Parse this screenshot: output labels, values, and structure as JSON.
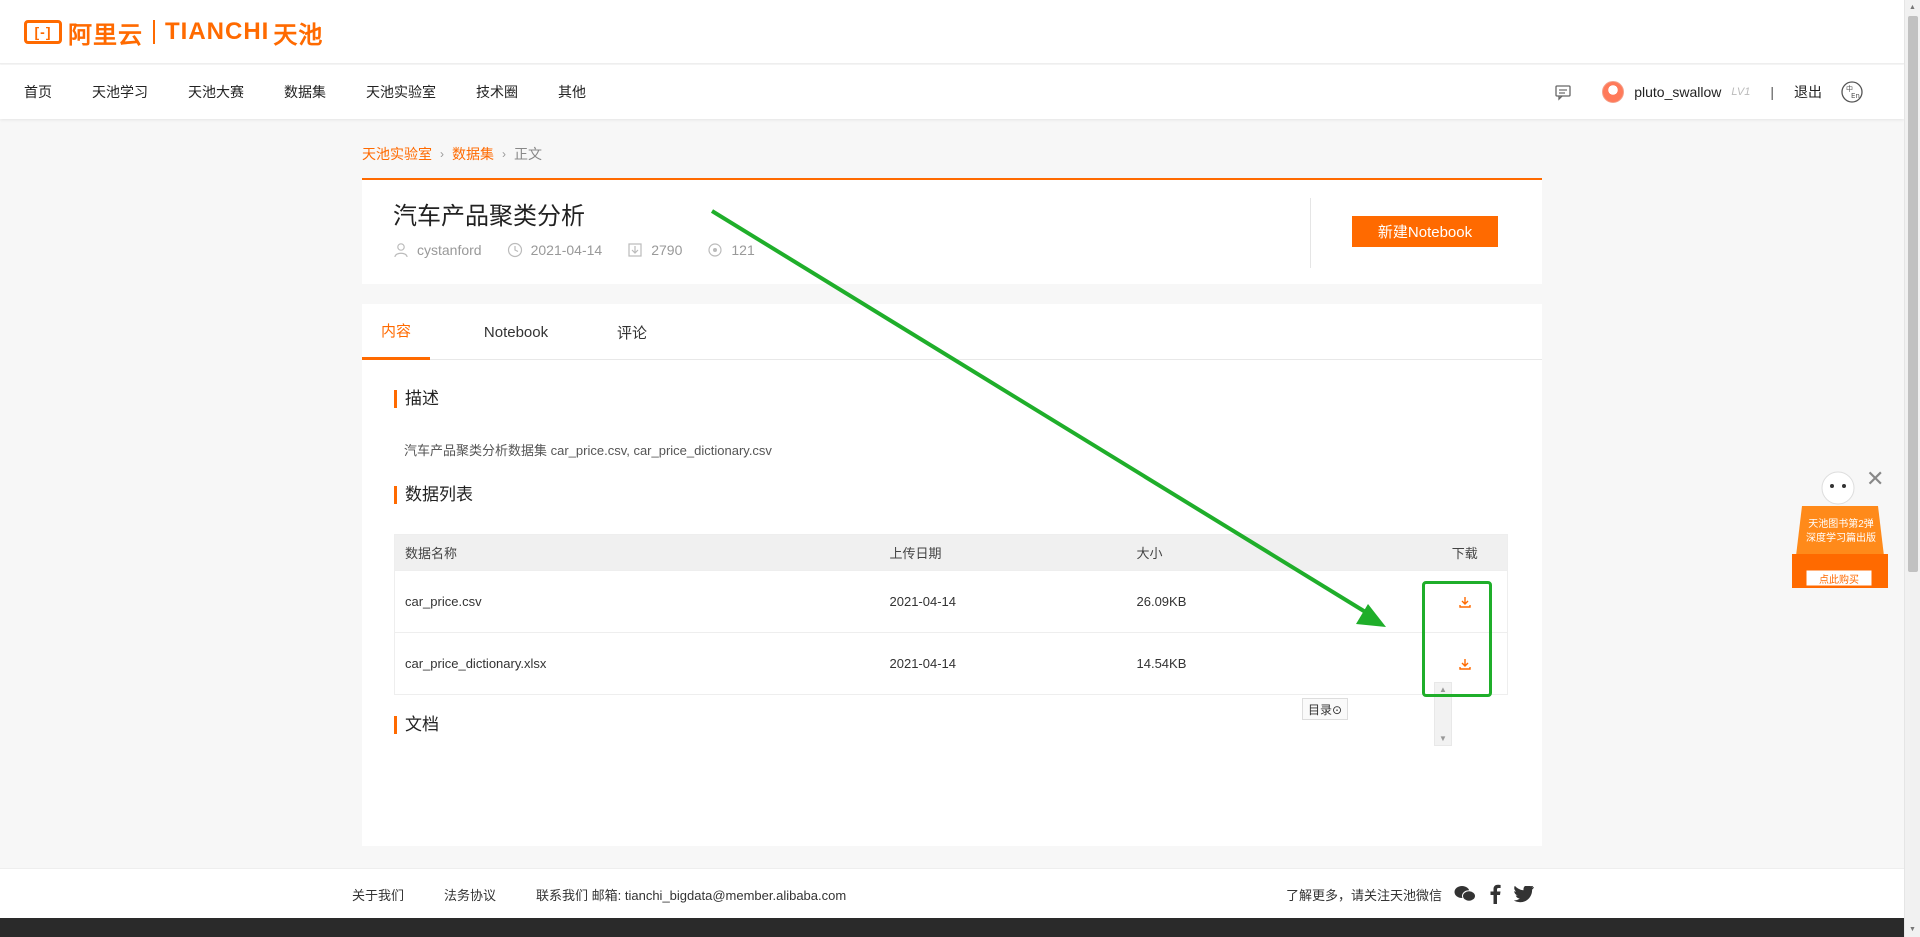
{
  "brand": {
    "logo_mark": "[-]",
    "logo_text_cn": "阿里云",
    "logo_text_en": "TIANCHI",
    "logo_text_tc": "天池",
    "accent_color": "#ff6a00"
  },
  "nav": {
    "items": [
      "首页",
      "天池学习",
      "天池大赛",
      "数据集",
      "天池实验室",
      "技术圈",
      "其他"
    ],
    "username": "pluto_swallow",
    "level": "LV1",
    "divider": "|",
    "logout": "退出"
  },
  "breadcrumb": {
    "items": [
      "天池实验室",
      "数据集"
    ],
    "current": "正文",
    "sep": "›"
  },
  "dataset": {
    "title": "汽车产品聚类分析",
    "author": "cystanford",
    "date": "2021-04-14",
    "downloads": "2790",
    "views": "121",
    "new_notebook": "新建Notebook"
  },
  "tabs": [
    "内容",
    "Notebook",
    "评论"
  ],
  "sections": {
    "description_title": "描述",
    "description": "汽车产品聚类分析数据集 car_price.csv, car_price_dictionary.csv",
    "datalist_title": "数据列表",
    "doc_title": "文档",
    "toc": "目录⊙"
  },
  "table": {
    "headers": [
      "数据名称",
      "上传日期",
      "大小",
      "下载"
    ],
    "rows": [
      {
        "name": "car_price.csv",
        "date": "2021-04-14",
        "size": "26.09KB"
      },
      {
        "name": "car_price_dictionary.xlsx",
        "date": "2021-04-14",
        "size": "14.54KB"
      }
    ]
  },
  "promo": {
    "line1": "天池图书第2弹",
    "line2": "深度学习篇出版",
    "button": "点此购买"
  },
  "footer": {
    "links": [
      "关于我们",
      "法务协议",
      "联系我们 邮箱: tianchi_bigdata@member.alibaba.com"
    ],
    "follow": "了解更多，请关注天池微信"
  }
}
